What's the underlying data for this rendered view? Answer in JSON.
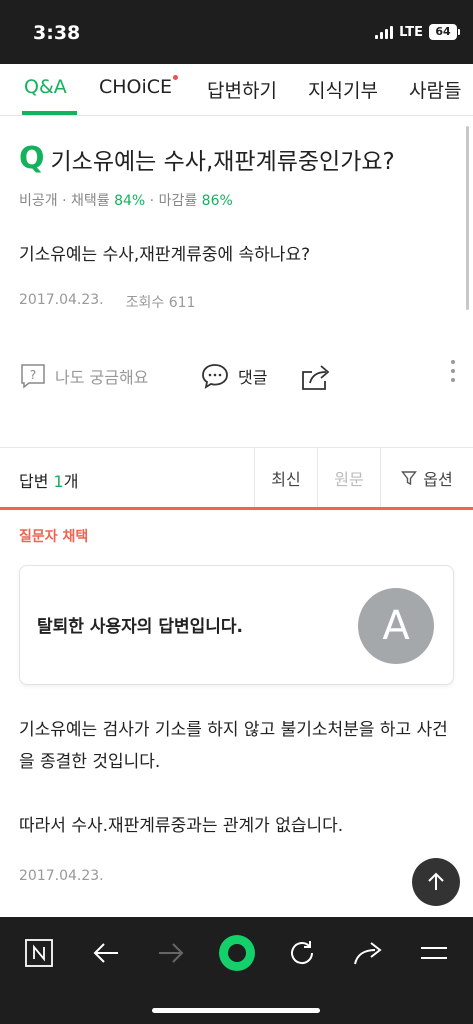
{
  "status_bar": {
    "time": "3:38",
    "network": "LTE",
    "battery": "64"
  },
  "tabs": [
    {
      "label": "Q&A",
      "active": true
    },
    {
      "label": "CHOiCE",
      "new_dot": true
    },
    {
      "label": "답변하기"
    },
    {
      "label": "지식기부"
    },
    {
      "label": "사람들"
    }
  ],
  "question": {
    "mark": "Q",
    "title": "기소유예는 수사,재판계류중인가요?",
    "meta_prefix": "비공개 · 채택률 ",
    "adoption_rate": "84%",
    "meta_mid": " · 마감률 ",
    "close_rate": "86%",
    "body": "기소유예는 수사,재판계류중에 속하나요?",
    "date": "2017.04.23.",
    "views": "조회수 611"
  },
  "actions": {
    "curious": "나도 궁금해요",
    "comment": "댓글"
  },
  "answers_header": {
    "label_prefix": "답변 ",
    "count": "1",
    "label_suffix": "개",
    "sort_latest": "최신",
    "sort_original": "원문",
    "filter": "옵션"
  },
  "answer": {
    "chosen_label": "질문자 채택",
    "author": "탈퇴한 사용자의 답변입니다.",
    "avatar_letter": "A",
    "paragraph1": "기소유예는 검사가 기소를 하지 않고 불기소처분을 하고 사건을 종결한 것입니다.",
    "paragraph2": "따라서 수사.재판계류중과는 관계가 없습니다.",
    "date": "2017.04.23."
  },
  "colors": {
    "accent": "#13b35e",
    "chosen": "#f06452",
    "bar": "#1e1e1e"
  },
  "icons": [
    "question-box-icon",
    "comment-icon",
    "share-icon",
    "more-icon",
    "filter-icon",
    "arrow-up-icon",
    "naver-n-icon",
    "back-icon",
    "forward-icon",
    "green-dot-icon",
    "reload-icon",
    "share-arrow-icon",
    "menu-icon"
  ]
}
